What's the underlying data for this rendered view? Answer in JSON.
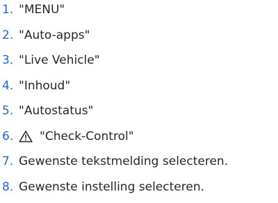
{
  "steps": [
    {
      "number": "1.",
      "text": "\"MENU\""
    },
    {
      "number": "2.",
      "text": "\"Auto-apps\""
    },
    {
      "number": "3.",
      "text": "\"Live Vehicle\""
    },
    {
      "number": "4.",
      "text": "\"Inhoud\""
    },
    {
      "number": "5.",
      "text": "\"Autostatus\""
    },
    {
      "number": "6.",
      "icon": "warning-triangle-icon",
      "text": "\"Check-Control\""
    },
    {
      "number": "7.",
      "text": "Gewenste tekstmelding selecteren."
    },
    {
      "number": "8.",
      "text": "Gewenste instelling selecteren."
    }
  ],
  "colors": {
    "number": "#1c69d4",
    "text": "#262626"
  }
}
